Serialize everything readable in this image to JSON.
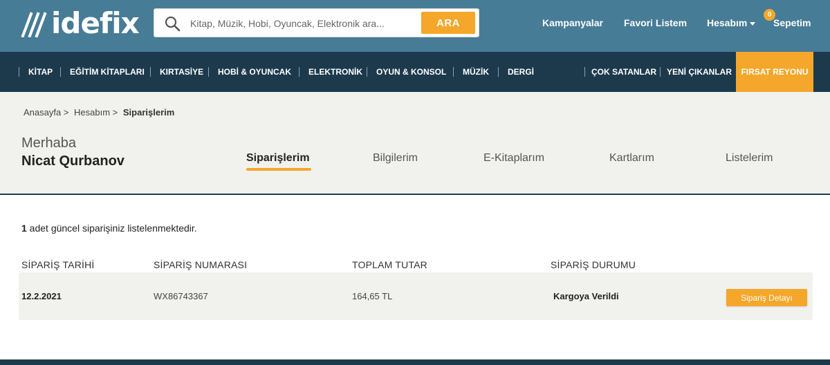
{
  "header": {
    "logo_text": "idefix",
    "search": {
      "placeholder": "Kitap, Müzik, Hobi, Oyuncak, Elektronik ara...",
      "value": "",
      "button_label": "ARA"
    },
    "links": {
      "campaigns": "Kampanyalar",
      "favorites": "Favori Listem",
      "account": "Hesabım",
      "cart": "Sepetim"
    },
    "cart_count": "0"
  },
  "categories": [
    "KİTAP",
    "EĞİTİM KİTAPLARI",
    "KIRTASİYE",
    "HOBİ & OYUNCAK",
    "ELEKTRONİK",
    "OYUN & KONSOL",
    "MÜZİK",
    "DERGİ",
    "ÇOK SATANLAR",
    "YENİ ÇIKANLAR",
    "FIRSAT REYONU"
  ],
  "breadcrumb": [
    "Anasayfa >",
    "Hesabım >",
    "Siparişlerim"
  ],
  "account": {
    "greeting": "Merhaba",
    "user_name": "Nicat Qurbanov",
    "tabs": [
      "Siparişlerim",
      "Bilgilerim",
      "E-Kitaplarım",
      "Kartlarım",
      "Listelerim"
    ],
    "active_tab": "Siparişlerim"
  },
  "orders": {
    "count": "1",
    "count_text": " adet güncel siparişiniz listelenmektedir.",
    "columns": [
      "SİPARİŞ TARİHİ",
      "SİPARİŞ NUMARASI",
      "TOPLAM TUTAR",
      "SİPARİŞ DURUMU"
    ],
    "rows": [
      {
        "date": "12.2.2021",
        "number": "WX86743367",
        "total": "164,65 TL",
        "status": "Kargoya Verildi",
        "action": "Sipariş Detayı"
      }
    ]
  },
  "colors": {
    "header_bg": "#477c97",
    "nav_bg": "#1d3a4d",
    "accent": "#f4a72a",
    "panel_bg": "#f1f2ee"
  }
}
